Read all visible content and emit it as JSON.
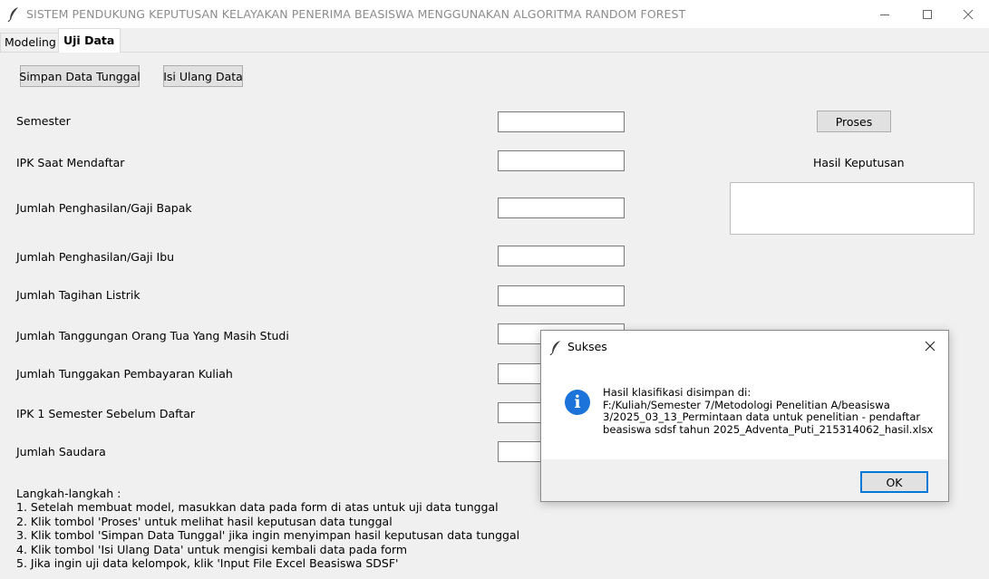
{
  "window": {
    "title": "SISTEM PENDUKUNG KEPUTUSAN KELAYAKAN PENERIMA BEASISWA MENGGUNAKAN ALGORITMA RANDOM FOREST",
    "minimize_icon": "minimize-icon",
    "maximize_icon": "maximize-icon",
    "close_icon": "close-icon"
  },
  "tabs": [
    {
      "label": "Modeling",
      "active": false
    },
    {
      "label": "Uji Data",
      "active": true
    }
  ],
  "toolbar": {
    "save_single_label": "Simpan Data Tunggal",
    "refill_label": "Isi Ulang Data"
  },
  "form": {
    "fields": [
      {
        "label": "Semester",
        "value": ""
      },
      {
        "label": "IPK Saat Mendaftar",
        "value": ""
      },
      {
        "label": "Jumlah Penghasilan/Gaji Bapak",
        "value": ""
      },
      {
        "label": "Jumlah Penghasilan/Gaji Ibu",
        "value": ""
      },
      {
        "label": "Jumlah Tagihan Listrik",
        "value": ""
      },
      {
        "label": "Jumlah Tanggungan Orang Tua Yang Masih Studi",
        "value": ""
      },
      {
        "label": "Jumlah Tunggakan Pembayaran Kuliah",
        "value": ""
      },
      {
        "label": "IPK 1 Semester Sebelum Daftar",
        "value": ""
      },
      {
        "label": "Jumlah Saudara",
        "value": ""
      }
    ]
  },
  "result": {
    "process_label": "Proses",
    "decision_label": "Hasil Keputusan",
    "decision_value": ""
  },
  "steps": {
    "heading": "Langkah-langkah :",
    "items": [
      "1. Setelah membuat model, masukkan data pada form di atas untuk uji data tunggal",
      "2. Klik tombol 'Proses' untuk melihat hasil keputusan data tunggal",
      "3. Klik tombol 'Simpan Data Tunggal' jika ingin menyimpan hasil keputusan data tunggal",
      "4. Klik tombol 'Isi Ulang Data' untuk mengisi kembali data pada form",
      "5. Jika ingin uji data kelompok, klik 'Input File Excel Beasiswa SDSF'"
    ]
  },
  "dialog": {
    "title": "Sukses",
    "message_lines": [
      "Hasil klasifikasi disimpan di:",
      "F:/Kuliah/Semester 7/Metodologi Penelitian A/beasiswa",
      "3/2025_03_13_Permintaan data untuk penelitian - pendaftar",
      "beasiswa sdsf tahun 2025_Adventa_Puti_215314062_hasil.xlsx"
    ],
    "ok_label": "OK",
    "icon": "info-icon",
    "info_icon_glyph": "i"
  },
  "colors": {
    "background": "#f0f0f0",
    "info_blue": "#1c73d9",
    "focus_border": "#0078d7"
  }
}
